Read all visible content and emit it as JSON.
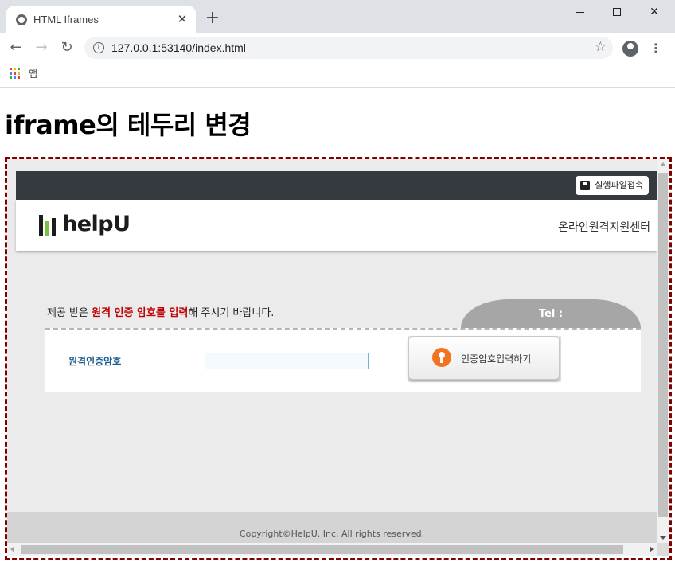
{
  "browser": {
    "tab_title": "HTML Iframes",
    "url": "127.0.0.1:53140/index.html",
    "bookmarks_apps_label": "앱",
    "icons": {
      "back": "arrow-left-icon",
      "forward": "arrow-right-icon",
      "reload": "reload-icon",
      "info": "info-icon",
      "star": "star-icon",
      "profile": "profile-icon",
      "menu": "kebab-menu-icon",
      "apps": "apps-grid-icon"
    }
  },
  "page": {
    "title": "iframe의 테두리 변경",
    "iframe_border_color": "#800000"
  },
  "helpu": {
    "exec_button_label": "실행파일접속",
    "logo_text": "helpU",
    "center_name": "온라인원격지원센터",
    "instruction": {
      "before": "제공 받은 ",
      "highlight": "원격 인증 암호를 입력",
      "after": "해 주시기 바랍니다."
    },
    "tel_label": "Tel :",
    "form": {
      "label": "원격인증암호",
      "input_value": "",
      "button_label": "인증암호입력하기"
    },
    "footer": "Copyright©HelpU. Inc. All rights reserved.",
    "colors": {
      "topbar": "#353a40",
      "highlight": "#c00000",
      "form_label": "#1a5a8c",
      "lock_icon": "#f27420",
      "logo_green": "#7cc242"
    }
  }
}
